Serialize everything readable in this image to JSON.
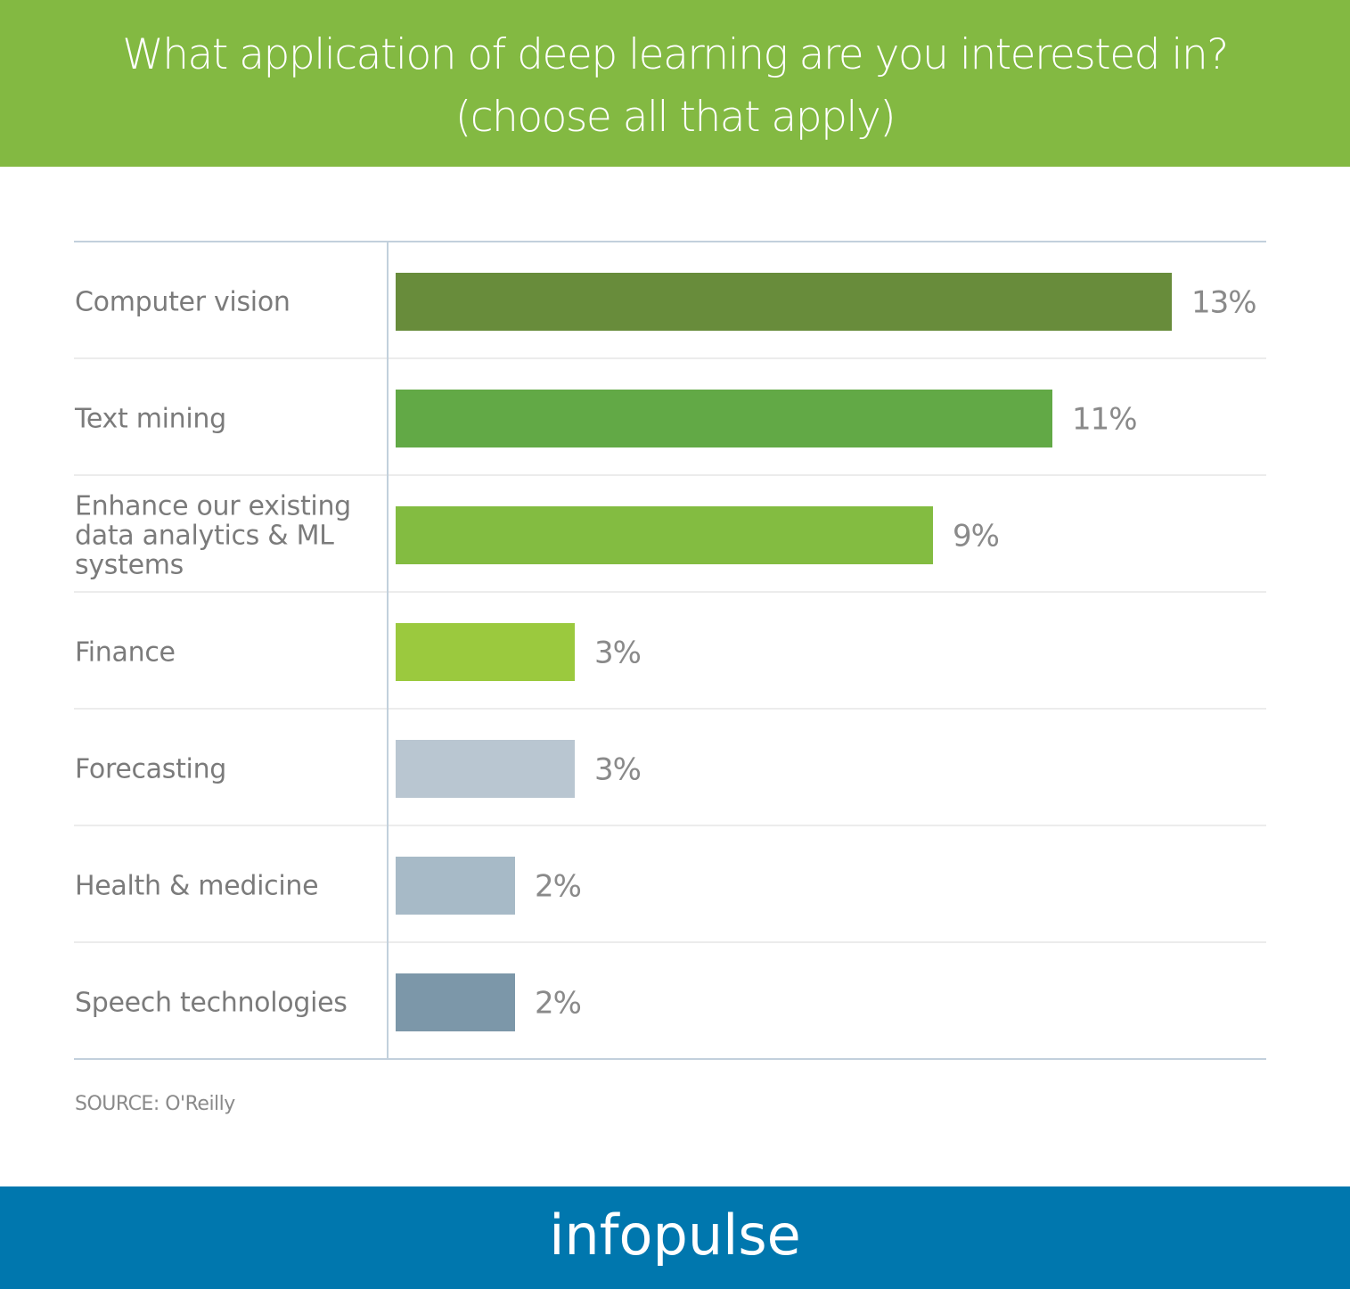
{
  "header": {
    "title_line1": "What application of deep learning are you interested in?",
    "title_line2": "(choose all that apply)",
    "background_color": "#83b942"
  },
  "chart_data": {
    "type": "bar",
    "orientation": "horizontal",
    "title": "What application of deep learning are you interested in? (choose all that apply)",
    "xlabel": "",
    "ylabel": "",
    "unit": "%",
    "grid": false,
    "categories": [
      [
        "Computer vision"
      ],
      [
        "Text mining"
      ],
      [
        "Enhance our existing",
        "data analytics & ML",
        "systems"
      ],
      [
        "Finance"
      ],
      [
        "Forecasting"
      ],
      [
        "Health & medicine"
      ],
      [
        "Speech technologies"
      ]
    ],
    "category_names": [
      "Computer vision",
      "Text mining",
      "Enhance our existing data analytics & ML systems",
      "Finance",
      "Forecasting",
      "Health & medicine",
      "Speech technologies"
    ],
    "values": [
      13,
      11,
      9,
      3,
      3,
      2,
      2
    ],
    "value_labels": [
      "13%",
      "11%",
      "9%",
      "3%",
      "3%",
      "2%",
      "2%"
    ],
    "colors": [
      "#688c3b",
      "#62a946",
      "#83bc41",
      "#9bc93e",
      "#b9c6d1",
      "#a7bac7",
      "#7c97a9"
    ],
    "xlim": [
      0,
      13
    ]
  },
  "source": "SOURCE: O'Reilly",
  "footer": {
    "logo_text": "infopulse",
    "background_color": "#0077ae"
  }
}
